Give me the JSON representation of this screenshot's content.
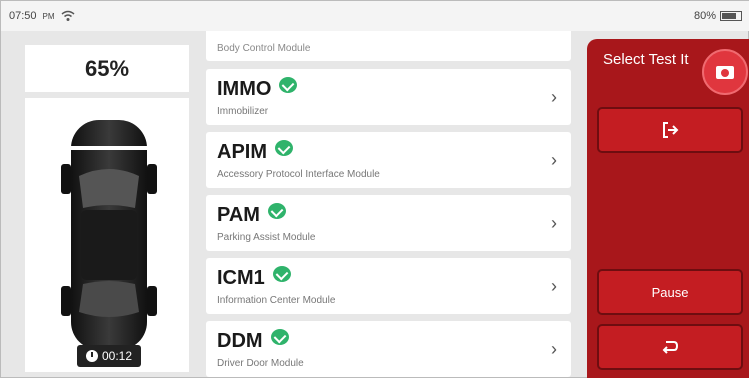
{
  "status_bar": {
    "time": "07:50",
    "ampm": "PM",
    "battery": "80%",
    "battery_level": 0.8
  },
  "progress": {
    "percent_label": "65%",
    "percent_value": 65
  },
  "timer": {
    "elapsed": "00:12"
  },
  "modules": {
    "partial_top": {
      "desc": "Body Control Module"
    },
    "items": [
      {
        "name": "IMMO",
        "desc": "Immobilizer"
      },
      {
        "name": "APIM",
        "desc": "Accessory Protocol Interface Module"
      },
      {
        "name": "PAM",
        "desc": "Parking Assist Module"
      },
      {
        "name": "ICM1",
        "desc": "Information Center Module"
      },
      {
        "name": "DDM",
        "desc": "Driver Door Module"
      }
    ],
    "chevron": "›"
  },
  "right_panel": {
    "title": "Select Test It",
    "pause_label": "Pause",
    "icons": {
      "camera": "camera-icon",
      "exit": "exit-icon",
      "back": "back-icon"
    }
  },
  "colors": {
    "accent_red": "#a8171b",
    "button_red": "#c41d22",
    "check_green": "#2fb36b"
  }
}
